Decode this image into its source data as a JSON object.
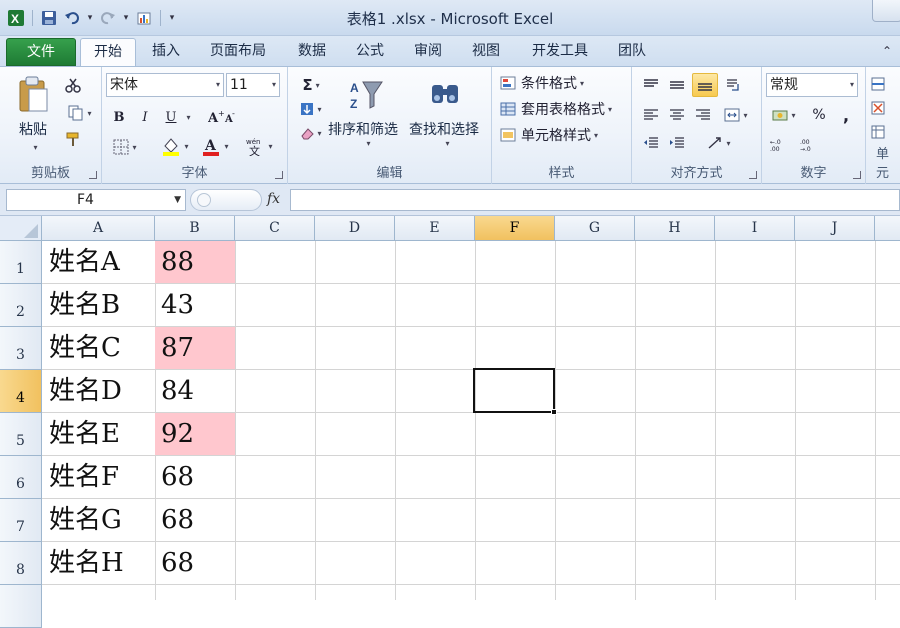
{
  "window": {
    "title": "表格1 .xlsx - Microsoft Excel"
  },
  "ribbon_tabs": [
    "文件",
    "开始",
    "插入",
    "页面布局",
    "数据",
    "公式",
    "审阅",
    "视图",
    "开发工具",
    "团队"
  ],
  "active_tab": "开始",
  "groups": {
    "clipboard": {
      "label": "剪贴板",
      "paste": "粘贴"
    },
    "font": {
      "label": "字体",
      "name": "宋体",
      "size": "11",
      "bold": "B",
      "italic": "I",
      "underline": "U"
    },
    "editing": {
      "label": "编辑",
      "sort_filter": "排序和筛选",
      "find_select": "查找和选择"
    },
    "styles": {
      "label": "样式",
      "conditional": "条件格式",
      "table_format": "套用表格格式",
      "cell_styles": "单元格样式"
    },
    "alignment": {
      "label": "对齐方式"
    },
    "number": {
      "label": "数字",
      "format": "常规",
      "percent": "%",
      "comma": ","
    },
    "cells": {
      "label": "单元"
    }
  },
  "formula_bar": {
    "name_box": "F4",
    "fx": "fx",
    "formula": ""
  },
  "columns": [
    "A",
    "B",
    "C",
    "D",
    "E",
    "F",
    "G",
    "H",
    "I",
    "J"
  ],
  "selected_column": "F",
  "selected_row": "4",
  "rows": [
    {
      "num": "1",
      "name": "姓名A",
      "score": "88",
      "highlight": true
    },
    {
      "num": "2",
      "name": "姓名B",
      "score": "43",
      "highlight": false
    },
    {
      "num": "3",
      "name": "姓名C",
      "score": "87",
      "highlight": true
    },
    {
      "num": "4",
      "name": "姓名D",
      "score": "84",
      "highlight": false
    },
    {
      "num": "5",
      "name": "姓名E",
      "score": "92",
      "highlight": true
    },
    {
      "num": "6",
      "name": "姓名F",
      "score": "68",
      "highlight": false
    },
    {
      "num": "7",
      "name": "姓名G",
      "score": "68",
      "highlight": false
    },
    {
      "num": "8",
      "name": "姓名H",
      "score": "68",
      "highlight": false
    }
  ],
  "colors": {
    "highlight_fill": "#ffc7ce",
    "file_tab": "#2a8c3f",
    "selected_header": "#f5cc6e"
  }
}
